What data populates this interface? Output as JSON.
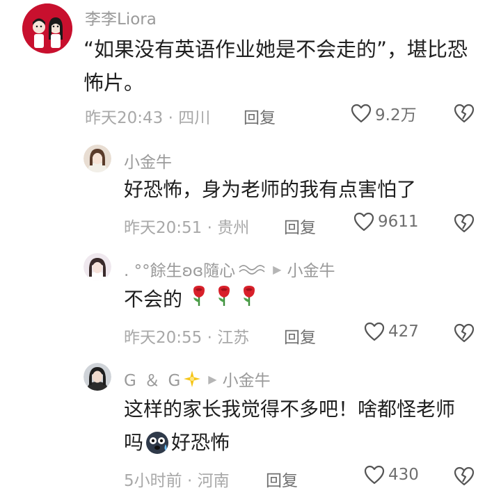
{
  "comments": [
    {
      "user": "李李Liora",
      "text_line1": "“如果没有英语作业她是不会走的”，堪比恐",
      "text_line2": "怖片。",
      "time": "昨天20:43 · 四川",
      "reply_label": "回复",
      "likes": "9.2万"
    },
    {
      "user": "小金牛",
      "text": "好恐怖，身为老师的我有点害怕了",
      "time": "昨天20:51 · 贵州",
      "reply_label": "回复",
      "likes": "9611"
    },
    {
      "user": ". °°餘生ʚɞ隨心",
      "reply_to": "小金牛",
      "text": "不会的",
      "emoji": "rose-emoji ×3",
      "time": "昨天20:55 · 江苏",
      "reply_label": "回复",
      "likes": "427"
    },
    {
      "user": "G ＆ G",
      "reply_to": "小金牛",
      "text_line1": "这样的家长我觉得不多吧！啥都怪老师",
      "text_line2a": "吗",
      "text_line2b": "好恐怖",
      "emoji": "scared-face-emoji",
      "time": "5小时前 · 河南",
      "reply_label": "回复",
      "likes": "430"
    }
  ],
  "icons": {
    "like": "heart-outline-icon",
    "dislike": "broken-heart-icon",
    "arrow": "triangle-right-icon"
  },
  "colors": {
    "username": "#9a9a9a",
    "text": "#1f1f1f",
    "meta": "#a8a8a8",
    "accent_red": "#c8102e"
  }
}
